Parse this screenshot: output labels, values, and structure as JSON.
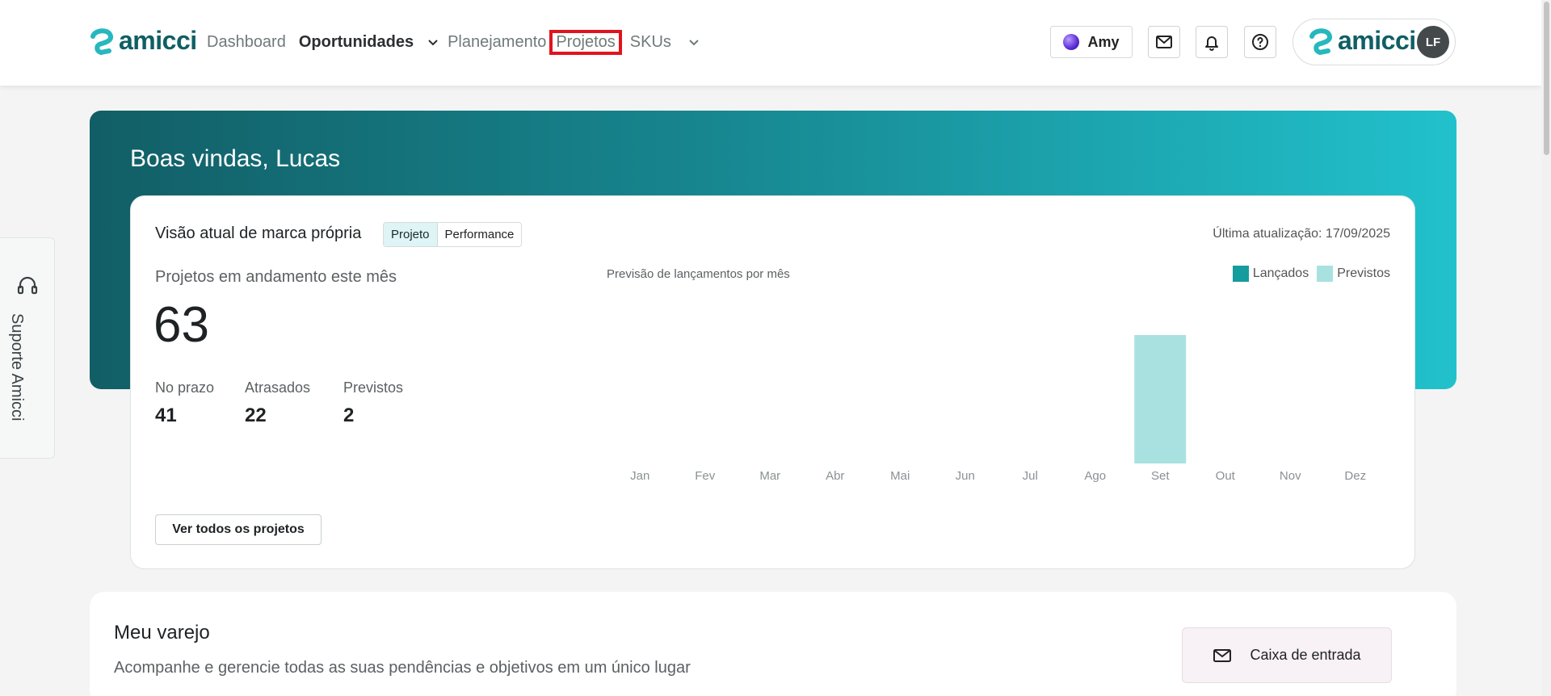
{
  "header": {
    "logo_text": "amicci",
    "nav": {
      "dashboard": "Dashboard",
      "oportunidades": "Oportunidades",
      "planejamento": "Planejamento",
      "projetos": "Projetos",
      "skus": "SKUs"
    },
    "assistant_label": "Amy",
    "profile_logo_text": "amicci",
    "avatar_initials": "LF",
    "highlight_color": "#e0141e"
  },
  "hero": {
    "greeting": "Boas vindas, Lucas"
  },
  "summary_card": {
    "title": "Visão atual de marca própria",
    "toggle": [
      "Projeto",
      "Performance"
    ],
    "toggle_active": "Projeto",
    "last_update": "Última atualização: 17/09/2025",
    "ongoing_label": "Projetos em andamento este mês",
    "ongoing_count": "63",
    "stats": [
      {
        "label": "No prazo",
        "value": "41"
      },
      {
        "label": "Atrasados",
        "value": "22"
      },
      {
        "label": "Previstos",
        "value": "2"
      }
    ],
    "see_all_button": "Ver todos os projetos"
  },
  "chart_data": {
    "type": "bar",
    "title": "Previsão de lançamentos por mês",
    "categories": [
      "Jan",
      "Fev",
      "Mar",
      "Abr",
      "Mai",
      "Jun",
      "Jul",
      "Ago",
      "Set",
      "Out",
      "Nov",
      "Dez"
    ],
    "series": [
      {
        "name": "Lançados",
        "color": "#159c9c",
        "values": [
          0,
          0,
          0,
          0,
          0,
          0,
          0,
          0,
          0,
          0,
          0,
          0
        ]
      },
      {
        "name": "Previstos",
        "color": "#a9e1e1",
        "values": [
          0,
          0,
          0,
          0,
          0,
          0,
          0,
          0,
          2,
          0,
          0,
          0
        ]
      }
    ],
    "ylim": [
      0,
      2
    ],
    "grid": false,
    "legend": "top-right",
    "xlabel": "",
    "ylabel": ""
  },
  "support": {
    "label": "Suporte Amicci"
  },
  "varejo": {
    "title": "Meu varejo",
    "subtitle": "Acompanhe e gerencie todas as suas pendências e objetivos em um único lugar",
    "inbox_button": "Caixa de entrada"
  }
}
